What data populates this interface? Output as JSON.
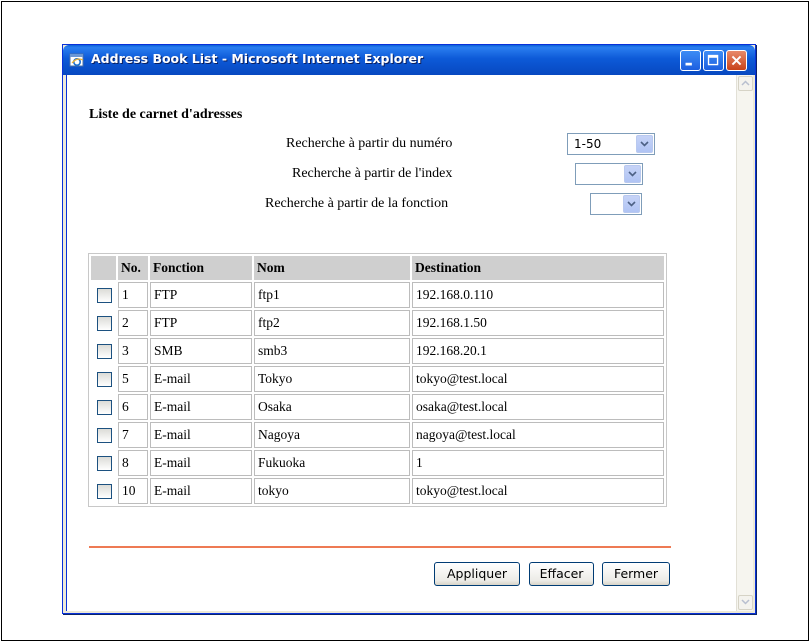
{
  "window": {
    "title": "Address Book List - Microsoft Internet Explorer"
  },
  "page": {
    "heading": "Liste de carnet d'adresses"
  },
  "search": {
    "by_number": {
      "label": "Recherche à partir du numéro",
      "value": "1-50"
    },
    "by_index": {
      "label": "Recherche à partir de l'index",
      "value": ""
    },
    "by_function": {
      "label": "Recherche à partir de la fonction",
      "value": ""
    }
  },
  "table": {
    "headers": {
      "check": "",
      "no": "No.",
      "function": "Fonction",
      "name": "Nom",
      "destination": "Destination"
    },
    "rows": [
      {
        "no": "1",
        "function": "FTP",
        "name": "ftp1",
        "destination": "192.168.0.110"
      },
      {
        "no": "2",
        "function": "FTP",
        "name": "ftp2",
        "destination": "192.168.1.50"
      },
      {
        "no": "3",
        "function": "SMB",
        "name": "smb3",
        "destination": "192.168.20.1"
      },
      {
        "no": "5",
        "function": "E-mail",
        "name": "Tokyo",
        "destination": "tokyo@test.local"
      },
      {
        "no": "6",
        "function": "E-mail",
        "name": "Osaka",
        "destination": "osaka@test.local"
      },
      {
        "no": "7",
        "function": "E-mail",
        "name": "Nagoya",
        "destination": "nagoya@test.local"
      },
      {
        "no": "8",
        "function": "E-mail",
        "name": "Fukuoka",
        "destination": "1"
      },
      {
        "no": "10",
        "function": "E-mail",
        "name": "tokyo",
        "destination": "tokyo@test.local"
      }
    ]
  },
  "buttons": {
    "apply": "Appliquer",
    "clear": "Effacer",
    "close": "Fermer"
  },
  "colors": {
    "titlebar": "#0a5fd8",
    "divider": "#ee7a54",
    "header_bg": "#cfcfcf"
  }
}
